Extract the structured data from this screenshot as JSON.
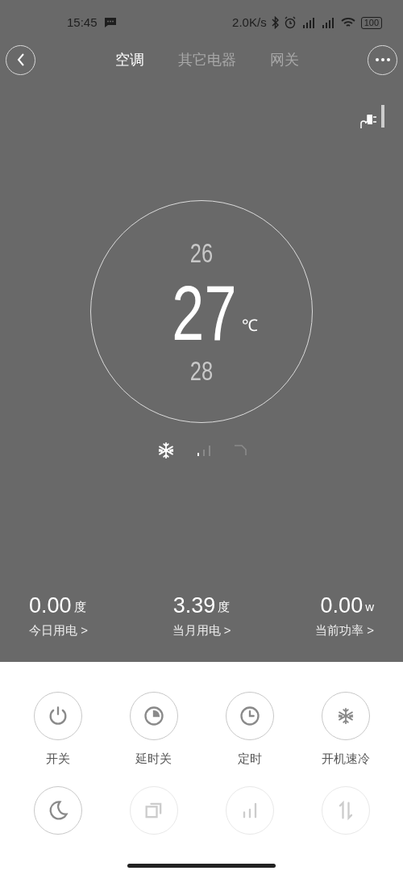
{
  "status_bar": {
    "time": "15:45",
    "network_speed": "2.0K/s",
    "battery": "100"
  },
  "nav": {
    "tabs": [
      {
        "label": "空调",
        "selected": true
      },
      {
        "label": "其它电器",
        "selected": false
      },
      {
        "label": "网关",
        "selected": false
      }
    ]
  },
  "temperature": {
    "above": "26",
    "current": "27",
    "unit": "℃",
    "below": "28"
  },
  "modes": [
    {
      "kind": "cool",
      "selected": true
    },
    {
      "kind": "fan",
      "selected": false
    },
    {
      "kind": "swing",
      "selected": false
    }
  ],
  "stats": [
    {
      "value": "0.00",
      "unit": "度",
      "label": "今日用电 >"
    },
    {
      "value": "3.39",
      "unit": "度",
      "label": "当月用电 >"
    },
    {
      "value": "0.00",
      "unit": "w",
      "label": "当前功率 >"
    }
  ],
  "controls": [
    {
      "kind": "power",
      "label": "开关",
      "disabled": false
    },
    {
      "kind": "delay",
      "label": "延时关",
      "disabled": false
    },
    {
      "kind": "timer",
      "label": "定时",
      "disabled": false
    },
    {
      "kind": "quickcool",
      "label": "开机速冷",
      "disabled": false
    },
    {
      "kind": "sleep",
      "disabled": false
    },
    {
      "kind": "mode",
      "disabled": true
    },
    {
      "kind": "speed",
      "disabled": true
    },
    {
      "kind": "swing",
      "disabled": true
    }
  ]
}
